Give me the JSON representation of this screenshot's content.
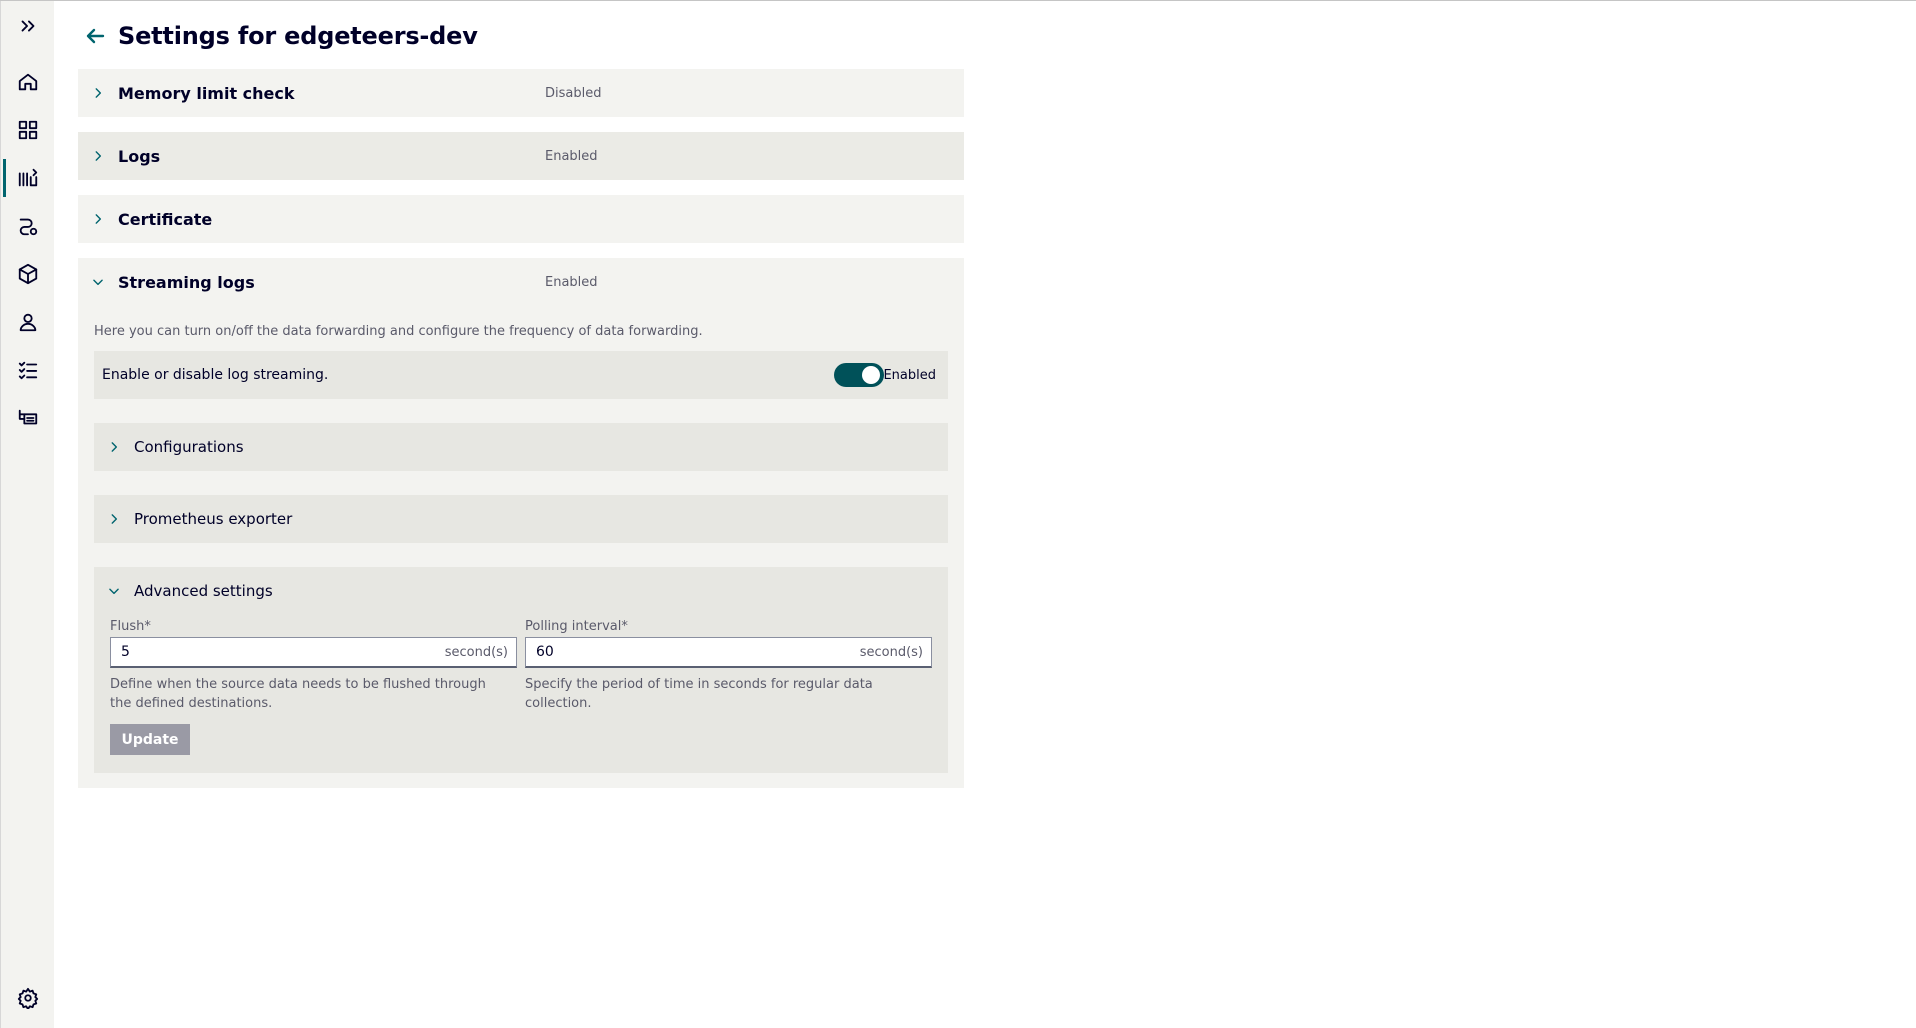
{
  "sidebar": {
    "items": [
      {
        "icon": "expand-icon"
      },
      {
        "icon": "home-icon"
      },
      {
        "icon": "dashboard-icon"
      },
      {
        "icon": "device-settings-icon"
      },
      {
        "icon": "connection-icon"
      },
      {
        "icon": "package-icon"
      },
      {
        "icon": "user-icon"
      },
      {
        "icon": "checklist-icon"
      },
      {
        "icon": "network-devices-icon"
      },
      {
        "icon": "gear-icon"
      }
    ],
    "accent": "#00646e"
  },
  "header": {
    "title": "Settings for edgeteers-dev"
  },
  "sections": {
    "memory": {
      "title": "Memory limit check",
      "status": "Disabled"
    },
    "logs": {
      "title": "Logs",
      "status": "Enabled"
    },
    "certificate": {
      "title": "Certificate"
    },
    "streaming": {
      "title": "Streaming logs",
      "status": "Enabled",
      "description": "Here you can turn on/off the data forwarding and configure the frequency of data forwarding.",
      "toggle_label": "Enable or disable log streaming.",
      "toggle_state": "Enabled",
      "toggle_on": true,
      "configurations": {
        "title": "Configurations"
      },
      "prometheus": {
        "title": "Prometheus exporter"
      },
      "advanced": {
        "title": "Advanced settings",
        "flush": {
          "label": "Flush*",
          "value": "5",
          "unit": "second(s)",
          "help": "Define when the source data needs to be flushed through the defined destinations."
        },
        "polling": {
          "label": "Polling interval*",
          "value": "60",
          "unit": "second(s)",
          "help": "Specify the period of time in seconds for regular data collection."
        },
        "update_label": "Update"
      }
    }
  }
}
